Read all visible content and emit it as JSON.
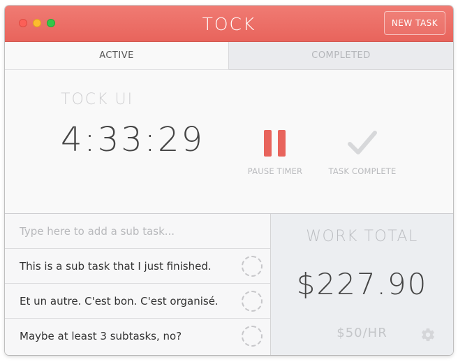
{
  "window": {
    "title": "TOCK",
    "new_task_label": "NEW TASK",
    "colors": {
      "accent": "#e8645c",
      "text_dark": "#454545",
      "muted": "#bcbec2"
    }
  },
  "tabs": [
    {
      "label": "ACTIVE",
      "selected": true
    },
    {
      "label": "COMPLETED",
      "selected": false
    }
  ],
  "timer_panel": {
    "task_name": "TOCK UI",
    "elapsed": "4:33:29",
    "pause_label": "PAUSE TIMER",
    "complete_label": "TASK COMPLETE"
  },
  "subtasks": {
    "placeholder": "Type here to add a sub task...",
    "items": [
      {
        "text": "This is a sub task that I just finished."
      },
      {
        "text": "Et un autre. C'est bon. C'est organisé."
      },
      {
        "text": "Maybe at least 3 subtasks, no?"
      }
    ]
  },
  "work_total": {
    "label": "WORK TOTAL",
    "amount": "$227.90",
    "rate": "$50/HR"
  },
  "icons": [
    "close-icon",
    "minimize-icon",
    "maximize-icon",
    "pause-icon",
    "check-icon",
    "checkbox-circle-icon",
    "gear-icon"
  ]
}
